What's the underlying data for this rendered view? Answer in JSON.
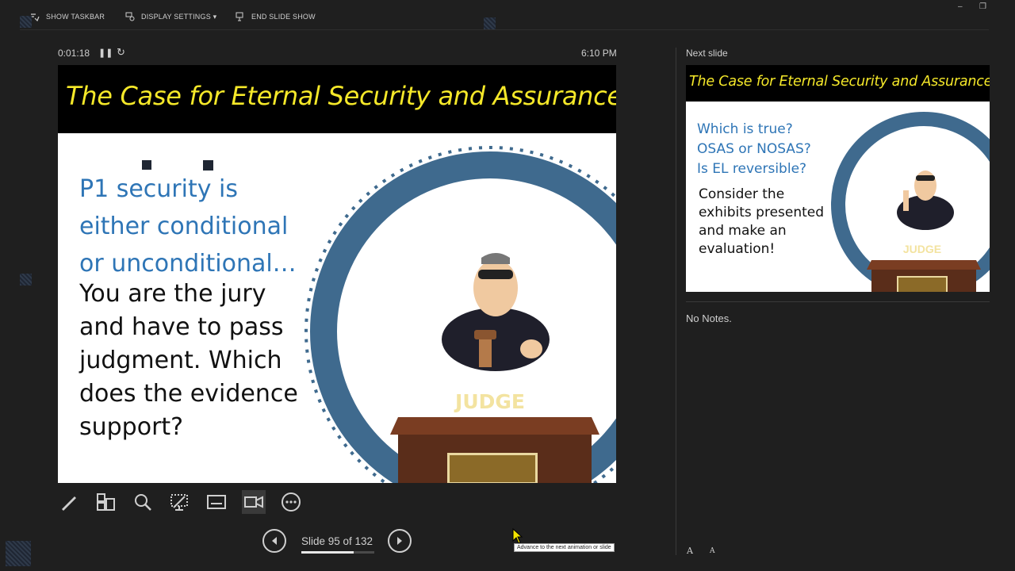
{
  "toolbar": {
    "show_taskbar": "SHOW TASKBAR",
    "display_settings": "DISPLAY SETTINGS ▾",
    "end_slide_show": "END SLIDE SHOW"
  },
  "window_controls": {
    "minimize": "–",
    "restore": "❐"
  },
  "presenter": {
    "timer": "0:01:18",
    "clock": "6:10 PM"
  },
  "current_slide": {
    "title": "The Case for Eternal Security and Assurance",
    "blue_lines": [
      "P1 security is",
      "either conditional",
      "or unconditional…"
    ],
    "black_lines": [
      "You are the jury",
      "and have to pass",
      "judgment. Which",
      "does the evidence",
      "support?"
    ],
    "judge_label": "JUDGE"
  },
  "next_slide": {
    "label": "Next slide",
    "title": "The Case for Eternal Security and Assurance",
    "blue_lines": [
      "Which is true?",
      "OSAS or NOSAS?",
      "Is EL reversible?"
    ],
    "black_lines": [
      "Consider the",
      "exhibits presented",
      "and make an",
      "evaluation!"
    ],
    "judge_label": "JUDGE"
  },
  "notes": "No Notes.",
  "navigation": {
    "slide_counter": "Slide 95 of 132",
    "progress_fraction": 0.72,
    "tooltip": "Advance to the next animation or slide"
  },
  "font_controls": {
    "increase": "A",
    "decrease": "A"
  },
  "colors": {
    "title_yellow": "#f5e829",
    "slide_blue": "#2e75b6",
    "background": "#1f1f1f"
  }
}
